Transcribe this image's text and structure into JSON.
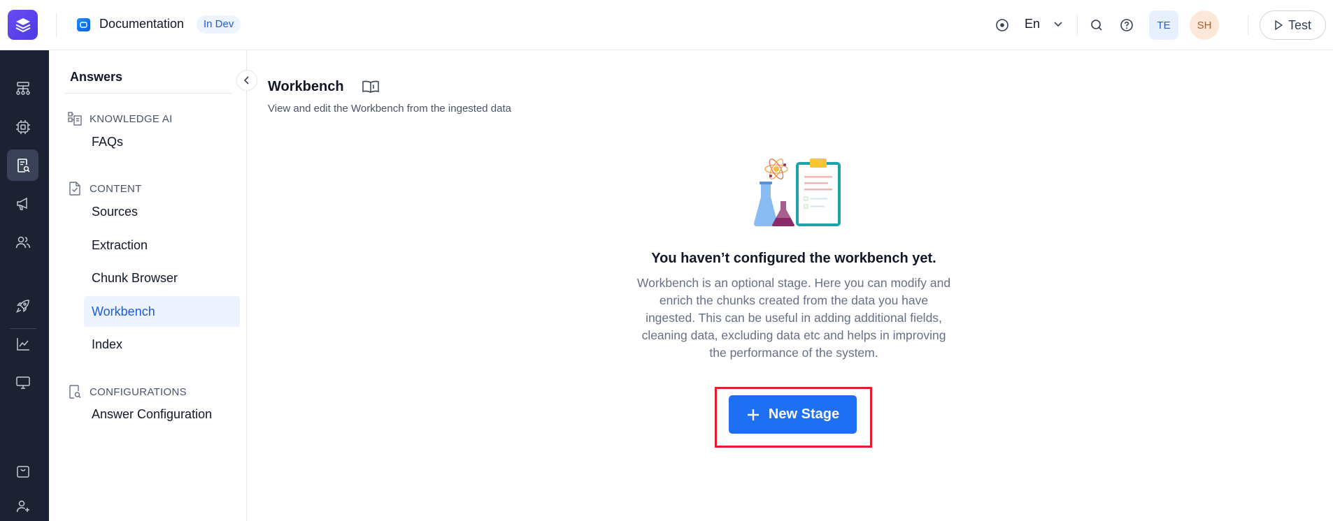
{
  "header": {
    "app_title": "Documentation",
    "status_badge": "In Dev",
    "language": "En",
    "avatars": [
      "TE",
      "SH"
    ],
    "test_label": "Test"
  },
  "rail": {
    "icons": [
      "flow-icon",
      "bot-icon",
      "search-doc-icon",
      "megaphone-icon",
      "users-icon",
      "rocket-icon",
      "analytics-icon",
      "monitor-icon",
      "store-icon",
      "add-user-icon"
    ],
    "active": "search-doc-icon"
  },
  "subnav": {
    "title": "Answers",
    "sections": [
      {
        "label": "KNOWLEDGE AI",
        "icon": "knowledge-icon",
        "items": [
          "FAQs"
        ]
      },
      {
        "label": "CONTENT",
        "icon": "content-icon",
        "items": [
          "Sources",
          "Extraction",
          "Chunk Browser",
          "Workbench",
          "Index"
        ]
      },
      {
        "label": "CONFIGURATIONS",
        "icon": "config-icon",
        "items": [
          "Answer Configuration"
        ]
      }
    ],
    "active_item": "Workbench"
  },
  "main": {
    "title": "Workbench",
    "subtitle": "View and edit the Workbench from the ingested data",
    "empty_state": {
      "title": "You haven’t configured the workbench yet.",
      "description": "Workbench is an optional stage. Here you can modify and enrich the chunks created from the data you have ingested. This can be useful in adding additional fields, cleaning data, excluding data etc and helps in improving the performance of the system.",
      "button_label": "New Stage"
    }
  },
  "colors": {
    "primary": "#1f6ff2",
    "rail_bg": "#1d2232",
    "highlight": "#e11d2e",
    "active_nav_bg": "#eef4ff"
  }
}
